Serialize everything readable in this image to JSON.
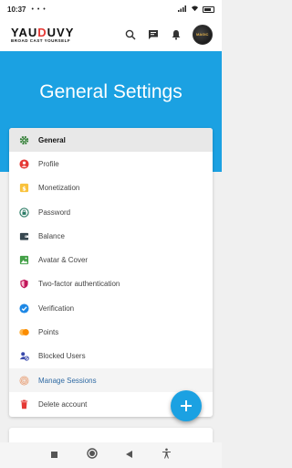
{
  "status_bar": {
    "time": "10:37",
    "dots": "• • •"
  },
  "app": {
    "logo_part1": "YAU",
    "logo_accent": "D",
    "logo_part2": "UVY",
    "tagline": "BROAD CAST YOURSELF"
  },
  "avatar_label": "MAGIC",
  "hero": {
    "title": "General Settings"
  },
  "menu": [
    {
      "label": "General",
      "icon": "gear-icon",
      "color": "#2e7d32"
    },
    {
      "label": "Profile",
      "icon": "user-circle-icon",
      "color": "#e53935"
    },
    {
      "label": "Monetization",
      "icon": "monetization-icon",
      "color": "#f9c23c"
    },
    {
      "label": "Password",
      "icon": "lock-icon",
      "color": "#2e7d67"
    },
    {
      "label": "Balance",
      "icon": "wallet-icon",
      "color": "#37474f"
    },
    {
      "label": "Avatar & Cover",
      "icon": "image-icon",
      "color": "#43a047"
    },
    {
      "label": "Two-factor authentication",
      "icon": "shield-icon",
      "color": "#c2185b"
    },
    {
      "label": "Verification",
      "icon": "check-circle-icon",
      "color": "#1e88e5"
    },
    {
      "label": "Points",
      "icon": "points-icon",
      "color": "#fb8c00"
    },
    {
      "label": "Blocked Users",
      "icon": "blocked-users-icon",
      "color": "#3949ab"
    },
    {
      "label": "Manage Sessions",
      "icon": "fingerprint-icon",
      "color": "#e8a27a"
    },
    {
      "label": "Delete account",
      "icon": "trash-icon",
      "color": "#e53935"
    }
  ],
  "colors": {
    "primary": "#1ba1e2"
  }
}
